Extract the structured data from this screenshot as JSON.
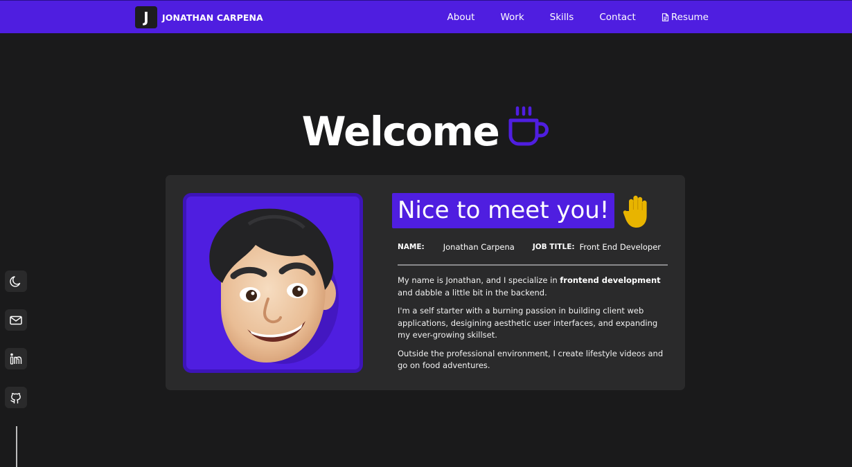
{
  "brand": {
    "logo_letter": "J",
    "name": "JONATHAN CARPENA"
  },
  "nav": {
    "items": [
      {
        "label": "About"
      },
      {
        "label": "Work"
      },
      {
        "label": "Skills"
      },
      {
        "label": "Contact"
      },
      {
        "label": "Resume",
        "icon": "document-icon"
      }
    ]
  },
  "hero": {
    "title": "Welcome",
    "icon": "coffee-cup-icon"
  },
  "profile": {
    "greeting": "Nice to meet you!",
    "greeting_icon": "raised-hand-icon",
    "name_label": "NAME:",
    "name_value": "Jonathan Carpena",
    "job_label": "JOB TITLE:",
    "job_value": "Front End Developer",
    "bio": {
      "p1_before": "My name is Jonathan, and I specialize in ",
      "p1_bold": "frontend development",
      "p1_after": " and dabble a little bit in the backend.",
      "p2": "I'm a self starter with a burning passion in building client web applications, desigining aesthetic user interfaces, and expanding my ever-growing skillset.",
      "p3": "Outside the professional environment, I create lifestyle videos and go on food adventures."
    }
  },
  "side_dock": {
    "items": [
      "moon-icon",
      "mail-icon",
      "linkedin-icon",
      "github-icon"
    ]
  },
  "colors": {
    "accent": "#4f1ee0",
    "background": "#1a1a1b",
    "card": "#2a2a2b",
    "hand": "#e8b400"
  }
}
